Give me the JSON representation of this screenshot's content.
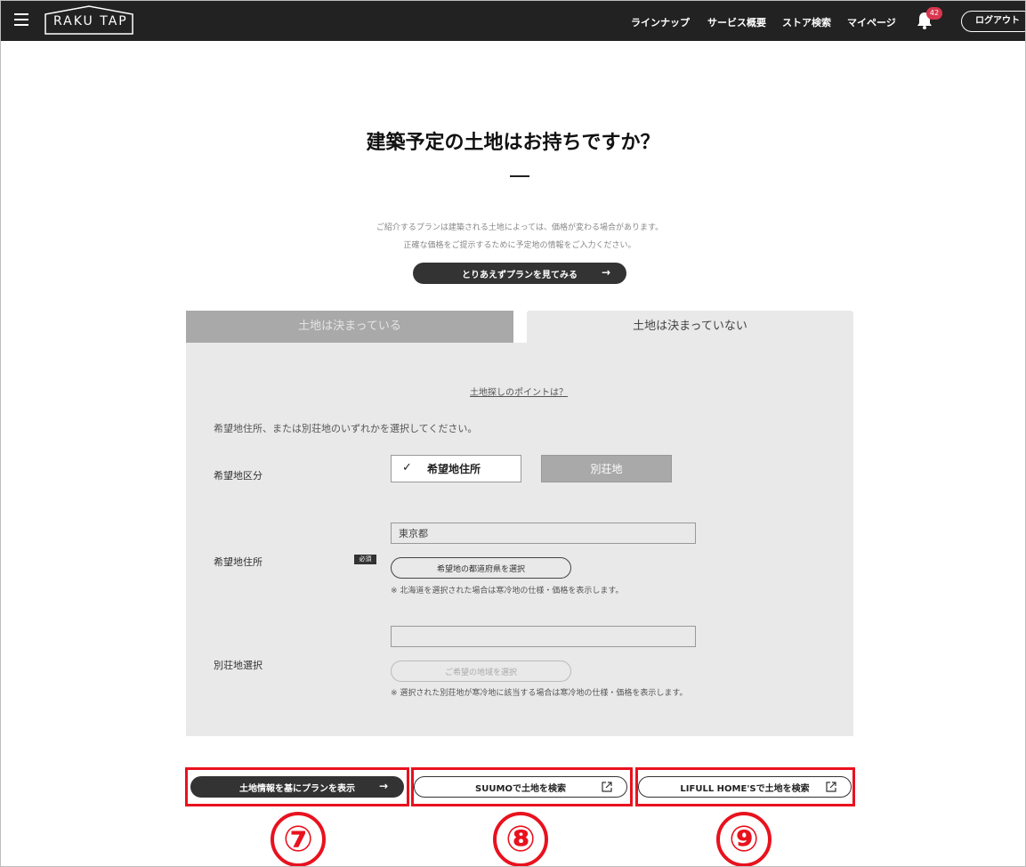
{
  "header": {
    "logo_text": "RAKU TAP",
    "nav": [
      "ラインナップ",
      "サービス概要",
      "ストア検索",
      "マイページ"
    ],
    "notification_count": "42",
    "logout_label": "ログアウト"
  },
  "intro": {
    "title": "建築予定の土地はお持ちですか？",
    "note_line1": "ご紹介するプランは建築される土地によっては、価格が変わる場合があります。",
    "note_line2": "正確な価格をご提示するために予定地の情報をご入力ください。",
    "quick_view_label": "とりあえずプランを見てみる"
  },
  "tabs": {
    "decided": "土地は決まっている",
    "undecided": "土地は決まっていない"
  },
  "form": {
    "tip_link": "土地探しのポイントは？",
    "lead": "希望地住所、または別荘地のいずれかを選択してください。",
    "category_label": "希望地区分",
    "option_address": "希望地住所",
    "option_villa": "別荘地",
    "address_label": "希望地住所",
    "required_badge": "必須",
    "address_value": "東京都",
    "select_prefecture_label": "希望地の都道府県を選択",
    "address_note": "※ 北海道を選択された場合は寒冷地の仕様・価格を表示します。",
    "villa_label": "別荘地選択",
    "villa_value": "",
    "select_area_label": "ご希望の地域を選択",
    "villa_note": "※ 選択された別荘地が寒冷地に該当する場合は寒冷地の仕様・価格を表示します。"
  },
  "actions": {
    "show_plan_label": "土地情報を基にプランを表示",
    "suumo_label": "SUUMOで土地を検索",
    "lifull_label": "LIFULL HOME'Sで土地を検索"
  },
  "annotations": [
    "⑦",
    "⑧",
    "⑨"
  ],
  "colors": {
    "header_bg": "#222222",
    "panel_bg": "#e9e9e9",
    "inactive_tab": "#a9a9a9",
    "badge": "#d9364e",
    "annotation_red": "#e8121e"
  }
}
